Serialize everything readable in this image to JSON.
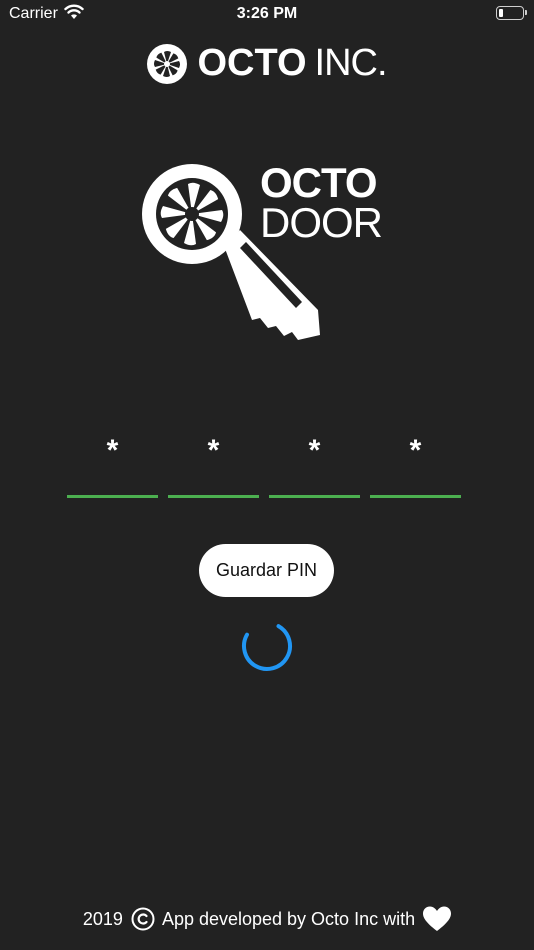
{
  "status_bar": {
    "carrier": "Carrier",
    "time": "3:26 PM",
    "wifi_icon": "wifi-icon",
    "battery_icon": "battery-icon"
  },
  "brand": {
    "logo_icon": "octo-fan-logo-icon",
    "name_bold": "OCTO",
    "name_light": "INC."
  },
  "app_logo": {
    "icon": "key-icon",
    "line1": "OCTO",
    "line2": "DOOR"
  },
  "pin": {
    "digits": [
      "*",
      "*",
      "*",
      "*"
    ],
    "underline_color": "#4caf50"
  },
  "actions": {
    "save_pin_label": "Guardar PIN"
  },
  "loading": {
    "spinner_icon": "loading-spinner-icon",
    "spinner_color": "#2196f3"
  },
  "footer": {
    "year": "2019",
    "copyright_icon": "copyright-icon",
    "text": "App developed by Octo Inc with",
    "heart_icon": "heart-icon"
  },
  "colors": {
    "background": "#222222",
    "accent_green": "#4caf50",
    "accent_blue": "#2196f3"
  }
}
